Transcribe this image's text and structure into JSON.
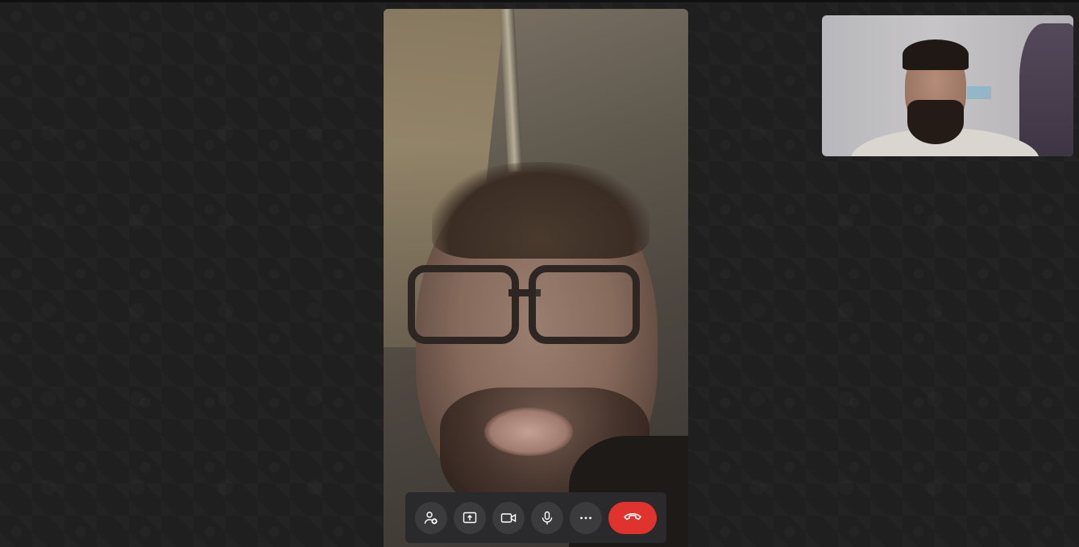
{
  "call": {
    "remote_participant": "remote-participant-video",
    "local_participant": "local-self-preview"
  },
  "controls": [
    {
      "id": "add-participant",
      "icon": "add-person-icon",
      "label": ""
    },
    {
      "id": "share-screen",
      "icon": "share-screen-icon",
      "label": ""
    },
    {
      "id": "camera",
      "icon": "video-camera-icon",
      "label": ""
    },
    {
      "id": "microphone",
      "icon": "microphone-icon",
      "label": ""
    },
    {
      "id": "more",
      "icon": "more-options-icon",
      "label": ""
    },
    {
      "id": "end-call",
      "icon": "hang-up-icon",
      "label": ""
    }
  ],
  "colors": {
    "background": "#1f1f1f",
    "control_bar": "#2a2a2c",
    "control_button": "#3b3b3d",
    "end_call": "#e0332e",
    "icon": "#ffffff"
  }
}
